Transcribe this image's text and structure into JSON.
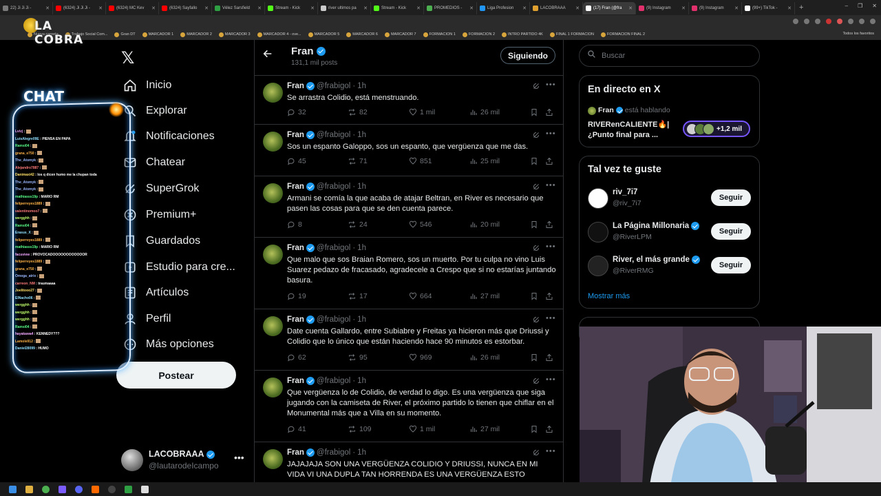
{
  "browser": {
    "tabs": [
      {
        "label": "22) Ji Ji Ji -",
        "color": "#7a7a7a"
      },
      {
        "label": "(6324) Ji Ji Ji -",
        "color": "#ff0000"
      },
      {
        "label": "(6324) MC Kev",
        "color": "#ff0000"
      },
      {
        "label": "(6324) Sayfallo",
        "color": "#ff0000"
      },
      {
        "label": "Vélez Sarsfield",
        "color": "#2ea043"
      },
      {
        "label": "Stream - Kick",
        "color": "#53fc18"
      },
      {
        "label": "river ultimos pa",
        "color": "#cccccc"
      },
      {
        "label": "Stream - Kick",
        "color": "#53fc18"
      },
      {
        "label": "PROMEDIOS -",
        "color": "#4caf50"
      },
      {
        "label": "Liga Profesion",
        "color": "#2196f3"
      },
      {
        "label": "LACOBRAAA",
        "color": "#e0a030"
      },
      {
        "label": "(17) Fran (@fra",
        "color": "#ffffff",
        "active": true
      },
      {
        "label": "(9) Instagram",
        "color": "#e1306c"
      },
      {
        "label": "(9) Instagram",
        "color": "#e1306c"
      },
      {
        "label": "(99+) TikTok -",
        "color": "#ffffff"
      }
    ],
    "bookmarks": [
      "Nueva carpeta",
      "Trabajo Social Com...",
      "Gran DT",
      "MARCADOR 1",
      "MARCADOR 2",
      "MARCADOR 3",
      "MARCADOR 4 - ove...",
      "MARCADOR 5",
      "MARCADOR 6",
      "MARCADOR 7",
      "FORMACION 1",
      "FORMACION 2",
      "INTRO PARTIDO 4K",
      "FINAL 1 FORMACION",
      "FORMACION FINAL 2"
    ],
    "all_bookmarks": "Todos los favoritos"
  },
  "overlay": {
    "logo_text": "LA COBRA",
    "chat_title": "CHAT",
    "chat": [
      {
        "user": "Lvizj",
        "text": "",
        "color": "#f2a7ff"
      },
      {
        "user": "LuisAlegre09E",
        "text": "PIENSA EN PAPA",
        "color": "#8fe0ff"
      },
      {
        "user": "Ramsi04",
        "text": "",
        "color": "#59ff8a"
      },
      {
        "user": "grana_e750",
        "text": "",
        "color": "#ffb347"
      },
      {
        "user": "The_Atomyk",
        "text": "",
        "color": "#9ab8ff"
      },
      {
        "user": "Alejandro7887",
        "text": "",
        "color": "#ff7b7b"
      },
      {
        "user": "Danimaxi42",
        "text": "los q dicen humo me la chupan toda",
        "color": "#ffe066"
      },
      {
        "user": "The_Atomyk",
        "text": "",
        "color": "#9ab8ff"
      },
      {
        "user": "The_Atomyk",
        "text": "",
        "color": "#9ab8ff"
      },
      {
        "user": "mathiasss19p",
        "text": "MARIO RM",
        "color": "#59ff8a"
      },
      {
        "user": "feliperreyes1889",
        "text": "",
        "color": "#ffb347"
      },
      {
        "user": "valentinomoo7",
        "text": "",
        "color": "#ff7b7b"
      },
      {
        "user": "wergghh",
        "text": "",
        "color": "#c0ff6b"
      },
      {
        "user": "Ramsi04",
        "text": "",
        "color": "#59ff8a"
      },
      {
        "user": "Erasus_X",
        "text": "",
        "color": "#8fe0ff"
      },
      {
        "user": "feliperreyes1889",
        "text": "",
        "color": "#ffb347"
      },
      {
        "user": "mathiasss19p",
        "text": "MARIO RM",
        "color": "#59ff8a"
      },
      {
        "user": "facuview",
        "text": "PROVOCADOOOOOOOOOOOOR",
        "color": "#f2a7ff"
      },
      {
        "user": "feliperreyes1889",
        "text": "",
        "color": "#ffb347"
      },
      {
        "user": "grana_e750",
        "text": "",
        "color": "#ffb347"
      },
      {
        "user": "Omega_atrix",
        "text": "",
        "color": "#9ab8ff"
      },
      {
        "user": "carreon_NM",
        "text": "traumaaaa",
        "color": "#ff7b7b"
      },
      {
        "user": "Joelitooo27",
        "text": "",
        "color": "#ffe066"
      },
      {
        "user": "ElNacho06",
        "text": "",
        "color": "#8fe0ff"
      },
      {
        "user": "wergghh",
        "text": "",
        "color": "#c0ff6b"
      },
      {
        "user": "wergghh",
        "text": "",
        "color": "#c0ff6b"
      },
      {
        "user": "wergghh",
        "text": "",
        "color": "#c0ff6b"
      },
      {
        "user": "Ramsi04",
        "text": "",
        "color": "#59ff8a"
      },
      {
        "user": "hayakawa4",
        "text": "KENNEDY???",
        "color": "#f2a7ff"
      },
      {
        "user": "Lamole912",
        "text": "",
        "color": "#ffb347"
      },
      {
        "user": "Daniel28099",
        "text": "HUMO",
        "color": "#8fe0ff"
      }
    ]
  },
  "nav": {
    "items": [
      {
        "label": "Inicio",
        "icon": "home-icon"
      },
      {
        "label": "Explorar",
        "icon": "search-icon"
      },
      {
        "label": "Notificaciones",
        "icon": "bell-icon"
      },
      {
        "label": "Chatear",
        "icon": "mail-icon"
      },
      {
        "label": "SuperGrok",
        "icon": "grok-icon"
      },
      {
        "label": "Premium+",
        "icon": "x-premium-icon"
      },
      {
        "label": "Guardados",
        "icon": "bookmark-icon"
      },
      {
        "label": "Estudio para cre...",
        "icon": "studio-icon"
      },
      {
        "label": "Artículos",
        "icon": "article-icon"
      },
      {
        "label": "Perfil",
        "icon": "person-icon"
      },
      {
        "label": "Más opciones",
        "icon": "more-circle-icon"
      }
    ],
    "post_button": "Postear",
    "account": {
      "name": "LACOBRAAA",
      "handle": "@lautarodeIcampo"
    }
  },
  "profile": {
    "name": "Fran",
    "posts_count": "131,1 mil posts",
    "follow_button": "Siguiendo"
  },
  "posts": [
    {
      "name": "Fran",
      "handle": "@frabigol",
      "time": "1h",
      "text": "Se arrastra Colidio, está menstruando.",
      "replies": "32",
      "reposts": "82",
      "likes": "1 mil",
      "views": "26 mil"
    },
    {
      "name": "Fran",
      "handle": "@frabigol",
      "time": "1h",
      "text": "Sos un espanto Galoppo, sos un espanto, que vergüenza que me das.",
      "replies": "45",
      "reposts": "71",
      "likes": "851",
      "views": "25 mil"
    },
    {
      "name": "Fran",
      "handle": "@frabigol",
      "time": "1h",
      "text": "Armani se comía la que acaba de atajar Beltran, en River es necesario que pasen las cosas para que se den cuenta parece.",
      "replies": "8",
      "reposts": "24",
      "likes": "546",
      "views": "20 mil"
    },
    {
      "name": "Fran",
      "handle": "@frabigol",
      "time": "1h",
      "text": "Que malo que sos Braian Romero, sos un muerto. Por tu culpa no vino Luis Suarez pedazo de fracasado, agradecele a Crespo que si no estarías juntando basura.",
      "replies": "19",
      "reposts": "17",
      "likes": "664",
      "views": "27 mil"
    },
    {
      "name": "Fran",
      "handle": "@frabigol",
      "time": "1h",
      "text": "Date cuenta Gallardo, entre Subiabre y Freitas ya hicieron más que Driussi y Colidio que lo único que están haciendo hace 90 minutos es estorbar.",
      "replies": "62",
      "reposts": "95",
      "likes": "969",
      "views": "26 mil"
    },
    {
      "name": "Fran",
      "handle": "@frabigol",
      "time": "1h",
      "text": "Que vergüenza lo de Colidio, de verdad lo digo. Es una vergüenza que siga jugando con la camiseta de River, el próximo partido lo tienen que chiflar en el Monumental más que a Villa en su momento.",
      "replies": "41",
      "reposts": "109",
      "likes": "1 mil",
      "views": "27 mil"
    },
    {
      "name": "Fran",
      "handle": "@frabigol",
      "time": "1h",
      "text": "JAJAJAJA SON UNA VERGÜENZA COLIDIO Y DRIUSSI, NUNCA EN MI VIDA VI UNA DUPLA TAN HORRENDA ES UNA VERGÜENZA ESTO",
      "replies": "",
      "reposts": "",
      "likes": "",
      "views": ""
    }
  ],
  "sidebar": {
    "search_placeholder": "Buscar",
    "live": {
      "heading": "En directo en X",
      "user": "Fran",
      "status": "está hablando",
      "title": "RIVERenCALIENTE🔥| ¿Punto final para ...",
      "listeners": "+1,2 mil"
    },
    "suggestions": {
      "heading": "Tal vez te guste",
      "items": [
        {
          "name": "riv_7i7",
          "handle": "@riv_7i7",
          "verified": false,
          "button": "Seguir",
          "color": "#ffffff"
        },
        {
          "name": "La Página Millonaria",
          "handle": "@RiverLPM",
          "verified": true,
          "button": "Seguir",
          "color": "#111111"
        },
        {
          "name": "River, el más grande",
          "handle": "@RiverRMG",
          "verified": true,
          "button": "Seguir",
          "color": "#222222"
        }
      ],
      "show_more": "Mostrar más"
    }
  },
  "colors": {
    "accent": "#1d9bf0",
    "background": "#000000",
    "border": "#2f3336",
    "muted_text": "#71767b"
  }
}
